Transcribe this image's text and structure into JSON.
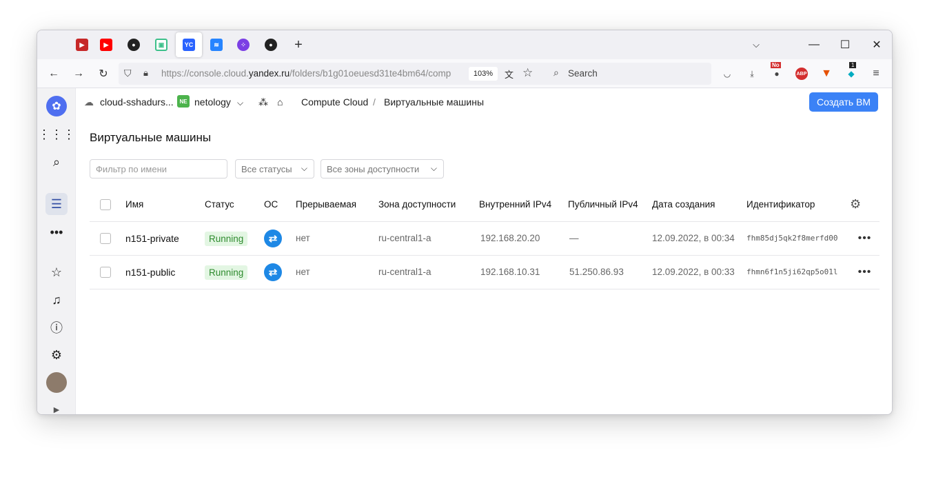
{
  "browser": {
    "tabs": [
      {
        "icon": "red-media-icon",
        "color": "#c62828",
        "label": ""
      },
      {
        "icon": "youtube-icon",
        "color": "#ff0000",
        "label": ""
      },
      {
        "icon": "github-icon",
        "color": "#222222",
        "label": ""
      },
      {
        "icon": "green-box-icon",
        "color": "#3cc08a",
        "label": ""
      },
      {
        "icon": "yandex-cloud-icon",
        "color": "#2962ff",
        "label": "YC"
      },
      {
        "icon": "jira-icon",
        "color": "#2684ff",
        "label": ""
      },
      {
        "icon": "colored-dots-icon",
        "color": "#7b3fe4",
        "label": ""
      },
      {
        "icon": "github-icon",
        "color": "#222222",
        "label": ""
      }
    ],
    "new_tab": "+",
    "url_prefix": "https://console.cloud.",
    "url_domain": "yandex.ru",
    "url_path": "/folders/b1g01oeuesd31te4bm64/comp",
    "zoom": "103%",
    "search_placeholder": "Search",
    "ext_no_badge": "No",
    "ext_abp": "ABP",
    "ext_count": "1"
  },
  "breadcrumbs": {
    "cloud": "cloud-sshadurs...",
    "folder_badge": "NE",
    "folder": "netology",
    "service": "Compute Cloud",
    "separator": "/",
    "current": "Виртуальные машины"
  },
  "create_button": "Создать ВМ",
  "page_title": "Виртуальные машины",
  "filters": {
    "name_placeholder": "Фильтр по имени",
    "status": "Все статусы",
    "zone": "Все зоны доступности"
  },
  "table": {
    "headers": [
      "Имя",
      "Статус",
      "ОС",
      "Прерываемая",
      "Зона доступности",
      "Внутренний IPv4",
      "Публичный IPv4",
      "Дата создания",
      "Идентификатор"
    ],
    "rows": [
      {
        "name": "n151-private",
        "status": "Running",
        "preemptible": "нет",
        "zone": "ru-central1-a",
        "internal_ip": "192.168.20.20",
        "public_ip": "—",
        "created": "12.09.2022, в 00:34",
        "id": "fhm85dj5qk2f8merfd00"
      },
      {
        "name": "n151-public",
        "status": "Running",
        "preemptible": "нет",
        "zone": "ru-central1-a",
        "internal_ip": "192.168.10.31",
        "public_ip": "51.250.86.93",
        "created": "12.09.2022, в 00:33",
        "id": "fhmn6f1n5ji62qp5o01l"
      }
    ]
  }
}
